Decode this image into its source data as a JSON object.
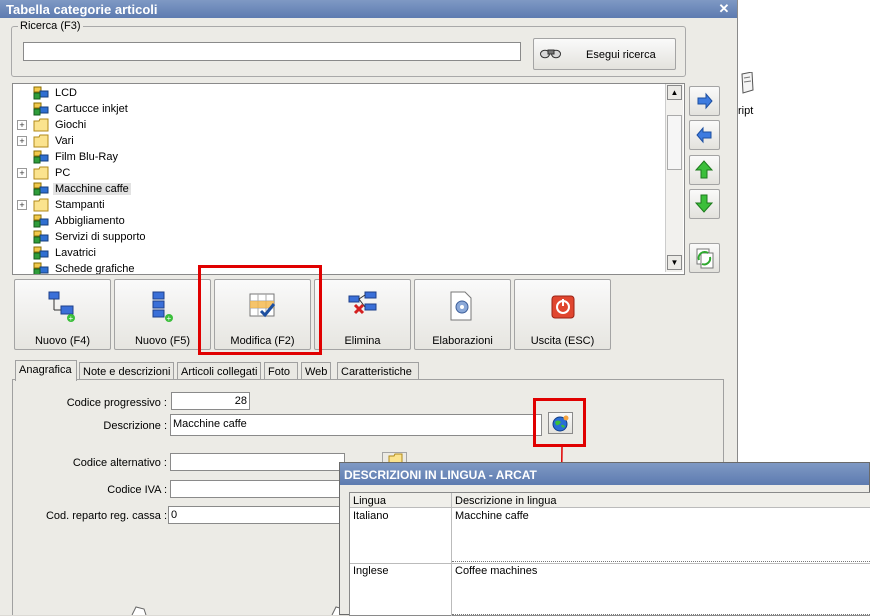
{
  "window": {
    "title": "Tabella categorie articoli",
    "close_glyph": "✕"
  },
  "desktop": {
    "icon_label": "ript"
  },
  "search": {
    "legend": "Ricerca (F3)",
    "value": "",
    "placeholder": "",
    "button_label": "Esegui ricerca",
    "button_icon": "binoculars-icon"
  },
  "tree": {
    "items": [
      {
        "label": "LCD",
        "icon": "category-icon",
        "expandable": false
      },
      {
        "label": "Cartucce inkjet",
        "icon": "category-icon",
        "expandable": false
      },
      {
        "label": "Giochi",
        "icon": "folder-icon",
        "expandable": true
      },
      {
        "label": "Vari",
        "icon": "folder-icon",
        "expandable": true
      },
      {
        "label": "Film Blu-Ray",
        "icon": "category-icon",
        "expandable": false
      },
      {
        "label": "PC",
        "icon": "folder-icon",
        "expandable": true
      },
      {
        "label": "Macchine caffe",
        "icon": "category-icon",
        "expandable": false,
        "selected": true
      },
      {
        "label": "Stampanti",
        "icon": "folder-icon",
        "expandable": true
      },
      {
        "label": "Abbigliamento",
        "icon": "category-icon",
        "expandable": false
      },
      {
        "label": "Servizi di supporto",
        "icon": "category-icon",
        "expandable": false
      },
      {
        "label": "Lavatrici",
        "icon": "category-icon",
        "expandable": false
      },
      {
        "label": "Schede grafiche",
        "icon": "category-icon",
        "expandable": false
      }
    ]
  },
  "nav_buttons": [
    "arrow-right-icon",
    "arrow-left-icon",
    "arrow-up-icon",
    "arrow-down-icon",
    "refresh-icon"
  ],
  "toolbar": {
    "new_f4": "Nuovo (F4)",
    "new_f5": "Nuovo (F5)",
    "edit": "Modifica (F2)",
    "delete": "Elimina",
    "process": "Elaborazioni",
    "exit": "Uscita (ESC)"
  },
  "tabs": [
    "Anagrafica",
    "Note e descrizioni",
    "Articoli collegati",
    "Foto",
    "Web",
    "Caratteristiche"
  ],
  "form": {
    "codice_progressivo_label": "Codice progressivo :",
    "codice_progressivo_value": "28",
    "descrizione_label": "Descrizione :",
    "descrizione_value": "Macchine caffe",
    "codice_alternativo_label": "Codice alternativo :",
    "codice_alternativo_value": "",
    "codice_iva_label": "Codice IVA :",
    "codice_iva_value": "",
    "cod_reparto_label": "Cod. reparto reg. cassa :",
    "cod_reparto_value": "0"
  },
  "popup": {
    "title": "DESCRIZIONI IN LINGUA - ARCAT",
    "columns": [
      "Lingua",
      "Descrizione in lingua"
    ],
    "rows": [
      {
        "lingua": "Italiano",
        "descrizione": "Macchine caffe"
      },
      {
        "lingua": "Inglese",
        "descrizione": "Coffee machines"
      }
    ]
  },
  "colors": {
    "titlebar": "#5d7bb0",
    "highlight": "#e00000"
  }
}
